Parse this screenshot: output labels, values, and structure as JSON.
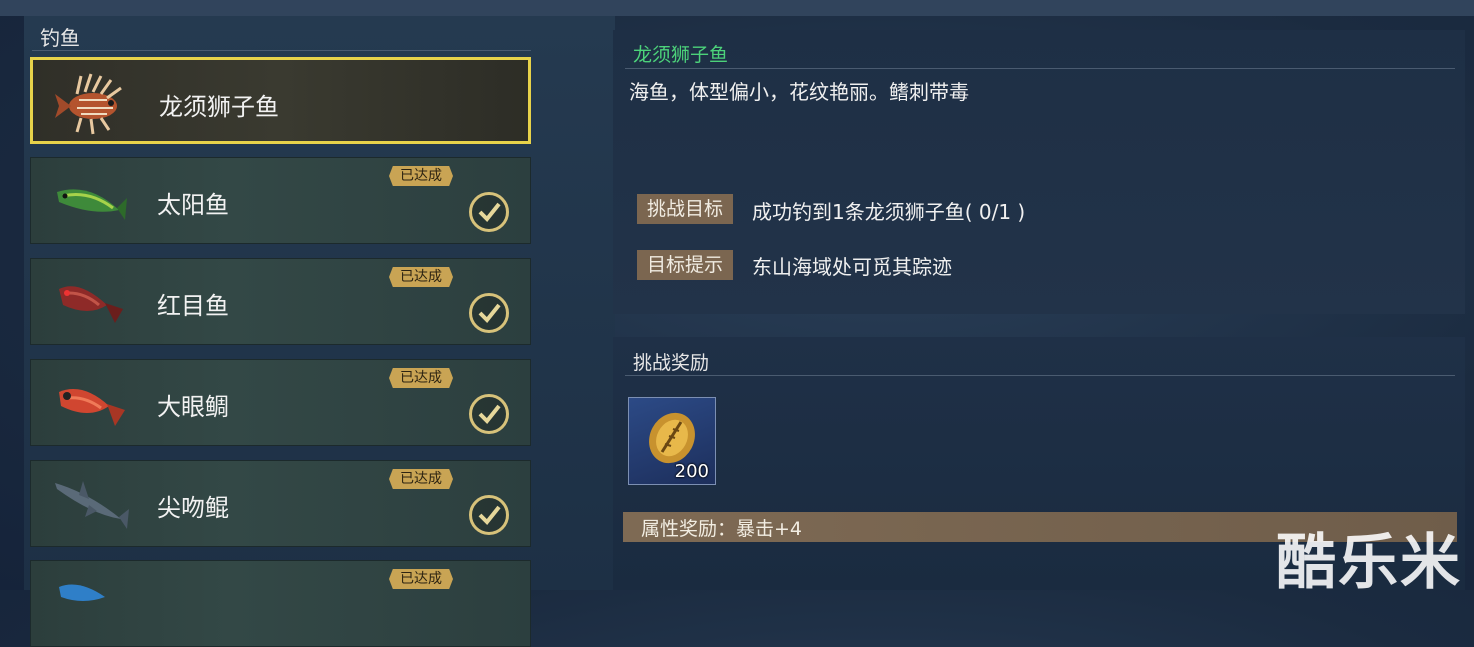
{
  "left_panel": {
    "title": "钓鱼",
    "fish": [
      {
        "name": "龙须狮子鱼",
        "selected": true,
        "achieved": false,
        "icon": "lionfish-icon"
      },
      {
        "name": "太阳鱼",
        "selected": false,
        "achieved": true,
        "icon": "sunfish-icon"
      },
      {
        "name": "红目鱼",
        "selected": false,
        "achieved": true,
        "icon": "red-eye-fish-icon"
      },
      {
        "name": "大眼鲷",
        "selected": false,
        "achieved": true,
        "icon": "bigeye-snapper-icon"
      },
      {
        "name": "尖吻鲲",
        "selected": false,
        "achieved": true,
        "icon": "shark-icon"
      },
      {
        "name": "",
        "selected": false,
        "achieved": true,
        "icon": "blue-fish-icon"
      }
    ],
    "badge_label": "已达成"
  },
  "detail": {
    "fish_title": "龙须狮子鱼",
    "description": "海鱼，体型偏小，花纹艳丽。鳍刺带毒",
    "challenge_goal_tag": "挑战目标",
    "challenge_goal_value": "成功钓到1条龙须狮子鱼( 0/1 )",
    "goal_hint_tag": "目标提示",
    "goal_hint_value": "东山海域处可觅其踪迹"
  },
  "reward": {
    "title": "挑战奖励",
    "item_icon": "gold-shell-icon",
    "item_count": "200",
    "attribute_bonus": "属性奖励：暴击+4"
  },
  "watermark": "酷乐米",
  "colors": {
    "selected_border": "#e7d24a",
    "fish_title_green": "#4cd27a",
    "badge_gold": "#c9a454",
    "tag_brown": "#7b6650"
  }
}
